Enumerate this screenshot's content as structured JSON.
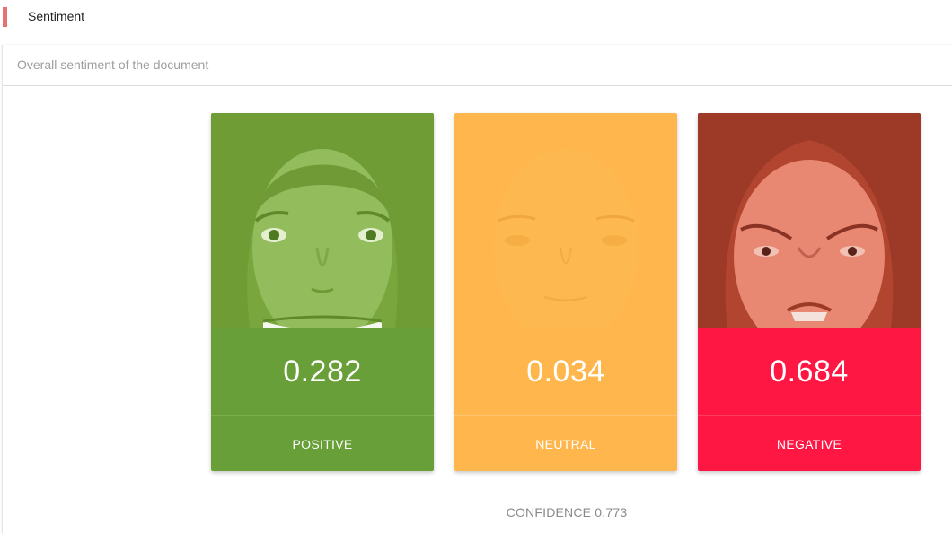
{
  "section": {
    "title": "Sentiment"
  },
  "panel": {
    "subtitle": "Overall sentiment of the document"
  },
  "cards": [
    {
      "id": "positive",
      "score": "0.282",
      "label": "POSITIVE",
      "color": "#689f38",
      "overlay": "#8bc34a",
      "icon": "happy-face-photo"
    },
    {
      "id": "neutral",
      "score": "0.034",
      "label": "NEUTRAL",
      "color": "#ffb74d",
      "overlay": "#ffb74d",
      "icon": "neutral-face-photo"
    },
    {
      "id": "negative",
      "score": "0.684",
      "label": "NEGATIVE",
      "color": "#ff1744",
      "overlay": "#ff5252",
      "icon": "angry-face-photo"
    }
  ],
  "confidence": {
    "text": "CONFIDENCE 0.773"
  }
}
